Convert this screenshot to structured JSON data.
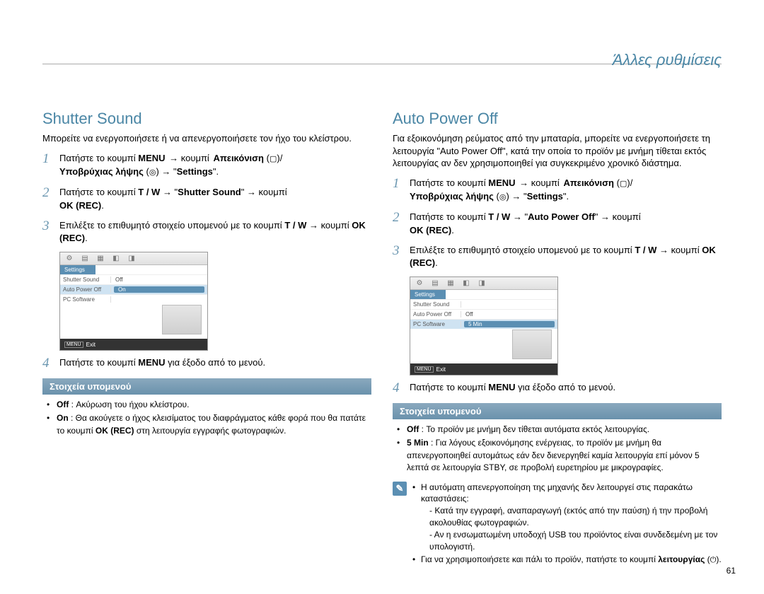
{
  "page_title": "Άλλες ρυθμίσεις",
  "page_number": "61",
  "left": {
    "heading": "Shutter Sound",
    "intro": "Μπορείτε να ενεργοποιήσετε ή να απενεργοποιήσετε τον ήχο του κλείστρου.",
    "step1_a": "Πατήστε το κουμπί ",
    "step1_menu": "MENU",
    "step1_b": " → κουμπί ",
    "step1_view": "Απεικόνιση",
    "step1_c": " (",
    "step1_viewicon": "▢",
    "step1_d": ")/",
    "step1_under": "Υποβρύχιας λήψης",
    "step1_e": " (",
    "step1_undericon": "◎",
    "step1_f": ") → \"",
    "step1_settings": "Settings",
    "step1_g": "\".",
    "step2_a": "Πατήστε το κουμπί ",
    "step2_tw": "T / W",
    "step2_b": " → \"",
    "step2_target": "Shutter Sound",
    "step2_c": "\" → κουμπί ",
    "step2_ok": "OK (REC)",
    "step2_d": ".",
    "step3_a": "Επιλέξτε το επιθυμητό στοιχείο υπομενού με το κουμπί ",
    "step3_tw": "T / W",
    "step3_b": " → κουμπί ",
    "step3_ok": "OK (REC)",
    "step3_c": ".",
    "step4_a": "Πατήστε το κουμπί ",
    "step4_menu": "MENU",
    "step4_b": " για έξοδο από το μενού.",
    "submenu_header": "Στοιχεία υπομενoύ",
    "off_label": "Off",
    "off_text": " : Ακύρωση του ήχου κλείστρου.",
    "on_label": "On",
    "on_text": " : Θα ακούγετε ο ήχος κλεισίματος του διαφράγματος κάθε φορά που θα πατάτε το κουμπί ",
    "on_ok": "OK (REC)",
    "on_text2": " στη λειτουργία εγγραφής φωτογραφιών.",
    "mock": {
      "tab": "Settings",
      "rows": [
        {
          "label": "Shutter Sound",
          "value": "Off"
        },
        {
          "label": "Auto Power Off",
          "value": "On"
        },
        {
          "label": "PC Software",
          "value": ""
        }
      ],
      "selected_index": 1,
      "footer_menu": "MENU",
      "footer_exit": "Exit"
    }
  },
  "right": {
    "heading": "Auto Power Off",
    "intro": "Για εξοικονόμηση ρεύματος από την μπαταρία, μπορείτε να ενεργοποιήσετε τη λειτουργία \"Auto Power Off\", κατά την οποία το προϊόν με μνήμη τίθεται εκτός λειτουργίας αν δεν χρησιμοποιηθεί για συγκεκριμένο χρονικό διάστημα.",
    "step1_a": "Πατήστε το κουμπί ",
    "step1_menu": "MENU",
    "step1_b": " → κουμπί ",
    "step1_view": "Απεικόνιση",
    "step1_c": " (",
    "step1_viewicon": "▢",
    "step1_d": ")/",
    "step1_under": "Υποβρύχιας λήψης",
    "step1_e": " (",
    "step1_undericon": "◎",
    "step1_f": ") → \"",
    "step1_settings": "Settings",
    "step1_g": "\".",
    "step2_a": "Πατήστε το κουμπί ",
    "step2_tw": "T / W",
    "step2_b": " → \"",
    "step2_target": "Auto Power Off",
    "step2_c": "\" → κουμπί ",
    "step2_ok": "OK (REC)",
    "step2_d": ".",
    "step3_a": "Επιλέξτε το επιθυμητό στοιχείο υπομενού με το κουμπί ",
    "step3_tw": "T / W",
    "step3_b": " → κουμπί ",
    "step3_ok": "OK (REC)",
    "step3_c": ".",
    "step4_a": "Πατήστε το κουμπί ",
    "step4_menu": "MENU",
    "step4_b": " για έξοδο από το μενού.",
    "submenu_header": "Στοιχεία υπομενoύ",
    "off_label": "Off",
    "off_text": " : Το προϊόν με μνήμη δεν τίθεται αυτόματα εκτός λειτουργίας.",
    "five_label": "5 Min",
    "five_text": " : Για λόγους εξοικονόμησης ενέργειας, το προϊόν με μνήμη θα απενεργοποιηθεί αυτομάτως εάν δεν διενεργηθεί καμία λειτουργία επί μόνον 5 λεπτά σε λειτουργία STBY, σε προβολή ευρετηρίου με μικρογραφίες.",
    "note_intro": "Η αυτόματη απενεργοποίηση της μηχανής δεν λειτουργεί στις παρακάτω καταστάσεις:",
    "note_dash1": "- Κατά την εγγραφή, αναπαραγωγή (εκτός από την παύση) ή την προβολή ακολουθίας φωτογραφιών.",
    "note_dash2": "- Αν η ενσωματωμένη υποδοχή USB του προϊόντος είναι συνδεδεμένη με τον υπολογιστή.",
    "note_b2_a": "Για να χρησιμοποιήσετε και πάλι το προϊόν, πατήστε το κουμπί ",
    "note_b2_bold": "λειτουργίας",
    "note_b2_b": " (",
    "note_b2_icon": "⏻",
    "note_b2_c": ").",
    "mock": {
      "tab": "Settings",
      "rows": [
        {
          "label": "Shutter Sound",
          "value": ""
        },
        {
          "label": "Auto Power Off",
          "value": "Off"
        },
        {
          "label": "PC Software",
          "value": "5 Min"
        }
      ],
      "selected_index": 2,
      "footer_menu": "MENU",
      "footer_exit": "Exit"
    }
  }
}
